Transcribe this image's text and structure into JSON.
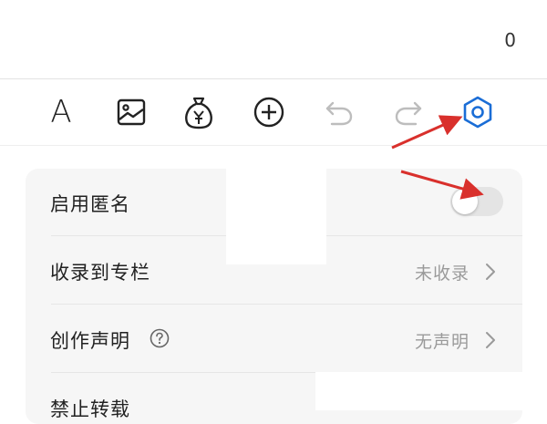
{
  "editor": {
    "char_count": "0"
  },
  "toolbar": {
    "items": [
      {
        "icon": "text-format-icon",
        "glyph": "A"
      },
      {
        "icon": "image-icon"
      },
      {
        "icon": "money-bag-icon"
      },
      {
        "icon": "add-circle-icon"
      },
      {
        "icon": "undo-icon"
      },
      {
        "icon": "redo-icon"
      },
      {
        "icon": "settings-icon"
      }
    ],
    "active_color": "#1a6dd6",
    "disabled_color": "#bdbdbd"
  },
  "settings": {
    "anonymous": {
      "label": "启用匿名",
      "enabled": false
    },
    "collection": {
      "label": "收录到专栏",
      "value": "未收录"
    },
    "statement": {
      "label": "创作声明",
      "value": "无声明"
    },
    "reprint": {
      "label": "禁止转载"
    }
  },
  "annotation_color": "#d9302c"
}
